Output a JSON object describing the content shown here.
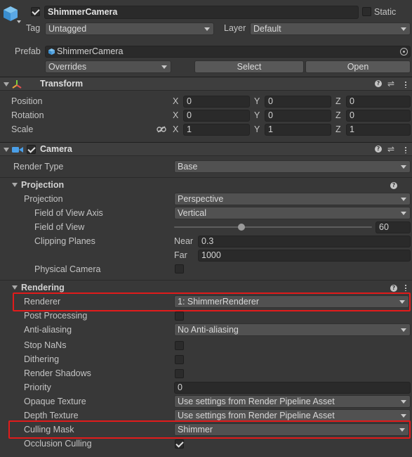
{
  "header": {
    "object_name": "ShimmerCamera",
    "static_label": "Static",
    "tag_label": "Tag",
    "tag_value": "Untagged",
    "layer_label": "Layer",
    "layer_value": "Default",
    "prefab_label": "Prefab",
    "prefab_value": "ShimmerCamera",
    "overrides_label": "Overrides",
    "select_label": "Select",
    "open_label": "Open"
  },
  "transform": {
    "title": "Transform",
    "axis_x": "X",
    "axis_y": "Y",
    "axis_z": "Z",
    "position": {
      "label": "Position",
      "x": "0",
      "y": "0",
      "z": "0"
    },
    "rotation": {
      "label": "Rotation",
      "x": "0",
      "y": "0",
      "z": "0"
    },
    "scale": {
      "label": "Scale",
      "x": "1",
      "y": "1",
      "z": "1"
    }
  },
  "camera": {
    "title": "Camera",
    "render_type_label": "Render Type",
    "render_type_value": "Base",
    "projection": {
      "title": "Projection",
      "projection_label": "Projection",
      "projection_value": "Perspective",
      "fov_axis_label": "Field of View Axis",
      "fov_axis_value": "Vertical",
      "fov_label": "Field of View",
      "fov_value": "60",
      "fov_fraction": 0.34,
      "clipping_label": "Clipping Planes",
      "near_label": "Near",
      "near_value": "0.3",
      "far_label": "Far",
      "far_value": "1000",
      "physical_camera_label": "Physical Camera",
      "physical_camera_checked": false
    },
    "rendering": {
      "title": "Rendering",
      "renderer_label": "Renderer",
      "renderer_value": "1: ShimmerRenderer",
      "post_processing_label": "Post Processing",
      "anti_aliasing_label": "Anti-aliasing",
      "anti_aliasing_value": "No Anti-aliasing",
      "stop_nans_label": "Stop NaNs",
      "dithering_label": "Dithering",
      "render_shadows_label": "Render Shadows",
      "priority_label": "Priority",
      "priority_value": "0",
      "opaque_texture_label": "Opaque Texture",
      "opaque_texture_value": "Use settings from Render Pipeline Asset",
      "depth_texture_label": "Depth Texture",
      "depth_texture_value": "Use settings from Render Pipeline Asset",
      "culling_mask_label": "Culling Mask",
      "culling_mask_value": "Shimmer",
      "occlusion_culling_label": "Occlusion Culling",
      "occlusion_culling_checked": true
    }
  },
  "colors": {
    "background": "#383838",
    "highlight_box": "#e11b1b",
    "camera_icon": "#4a9fe8"
  }
}
